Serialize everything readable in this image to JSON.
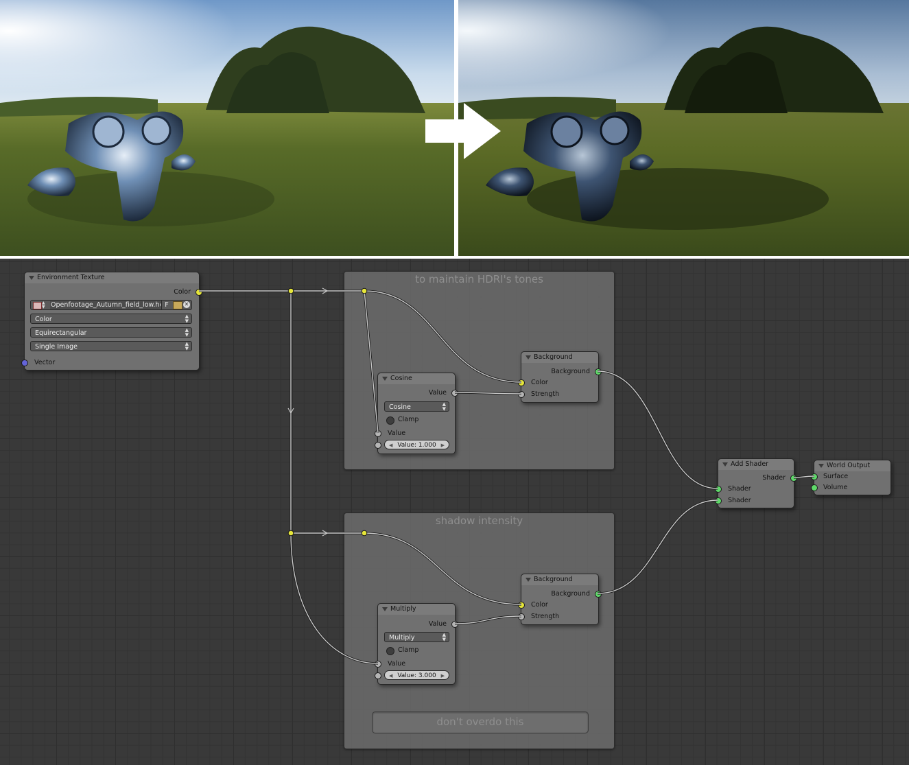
{
  "comparison": {
    "before_label": "",
    "after_label": ""
  },
  "frames": {
    "tones": {
      "label": "to maintain HDRI's tones"
    },
    "shadow": {
      "label": "shadow intensity"
    }
  },
  "note": {
    "text": "don't overdo this"
  },
  "nodes": {
    "env_texture": {
      "title": "Environment Texture",
      "output_color": "Color",
      "file_name": "Openfootage_Autumn_field_low.hdr",
      "file_button": "F",
      "color_space": "Color",
      "projection": "Equirectangular",
      "source": "Single Image",
      "input_vector": "Vector"
    },
    "cosine": {
      "title": "Cosine",
      "output_value": "Value",
      "operation": "Cosine",
      "clamp": "Clamp",
      "input_value": "Value",
      "value_field": "Value: 1.000"
    },
    "background_top": {
      "title": "Background",
      "output": "Background",
      "input_color": "Color",
      "input_strength": "Strength"
    },
    "multiply": {
      "title": "Multiply",
      "output_value": "Value",
      "operation": "Multiply",
      "clamp": "Clamp",
      "input_value": "Value",
      "value_field": "Value: 3.000"
    },
    "background_bottom": {
      "title": "Background",
      "output": "Background",
      "input_color": "Color",
      "input_strength": "Strength"
    },
    "add_shader": {
      "title": "Add Shader",
      "output": "Shader",
      "input_1": "Shader",
      "input_2": "Shader"
    },
    "world_output": {
      "title": "World Output",
      "input_surface": "Surface",
      "input_volume": "Volume"
    }
  },
  "colors": {
    "socket_color": "#e6e63a",
    "socket_shader": "#5fd96a",
    "socket_value": "#b5b5b5",
    "socket_vector": "#6464d8",
    "editor_bg": "#393939"
  }
}
